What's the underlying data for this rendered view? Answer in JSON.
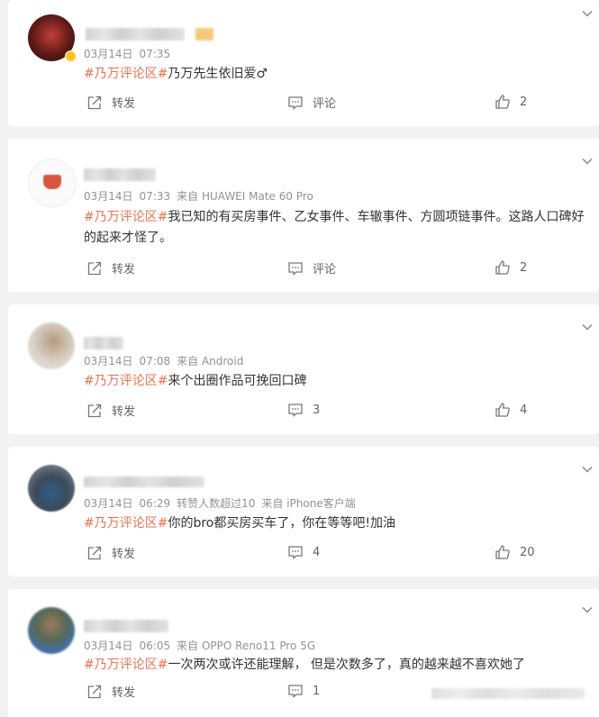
{
  "comments": [
    {
      "date": "03月14日",
      "time": "07:35",
      "extra": "",
      "source": "",
      "tag": "#乃万评论区#",
      "text": "乃万先生依旧爱♂",
      "repost": "转发",
      "comment": "评论",
      "likes": "2"
    },
    {
      "date": "03月14日",
      "time": "07:33",
      "extra": "",
      "source": "来自 HUAWEI Mate 60 Pro",
      "tag": "#乃万评论区#",
      "text": "我已知的有买房事件、乙女事件、车辙事件、方圆项链事件。这路人口碑好的起来才怪了。",
      "repost": "转发",
      "comment": "评论",
      "likes": "2"
    },
    {
      "date": "03月14日",
      "time": "07:08",
      "extra": "",
      "source": "来自 Android",
      "tag": "#乃万评论区#",
      "text": "来个出圈作品可挽回口碑",
      "repost": "转发",
      "comment": "3",
      "likes": "4"
    },
    {
      "date": "03月14日",
      "time": "06:29",
      "extra": "转赞人数超过10",
      "source": "来自 iPhone客户端",
      "tag": "#乃万评论区#",
      "text": "你的bro都买房买车了，你在等等吧!加油",
      "repost": "转发",
      "comment": "4",
      "likes": "20"
    },
    {
      "date": "03月14日",
      "time": "06:05",
      "extra": "",
      "source": "来自 OPPO Reno11 Pro 5G",
      "tag": "#乃万评论区#",
      "text": "一次两次或许还能理解， 但是次数多了，真的越来越不喜欢她了",
      "repost": "转发",
      "comment": "1",
      "likes": ""
    }
  ],
  "colors": {
    "tag": "#eb7350",
    "meta": "#939393",
    "background": "#f2f2f2"
  },
  "icons": {
    "repost": "share-icon",
    "comment": "comment-icon",
    "like": "thumbs-up-icon",
    "menu": "chevron-down-icon"
  }
}
